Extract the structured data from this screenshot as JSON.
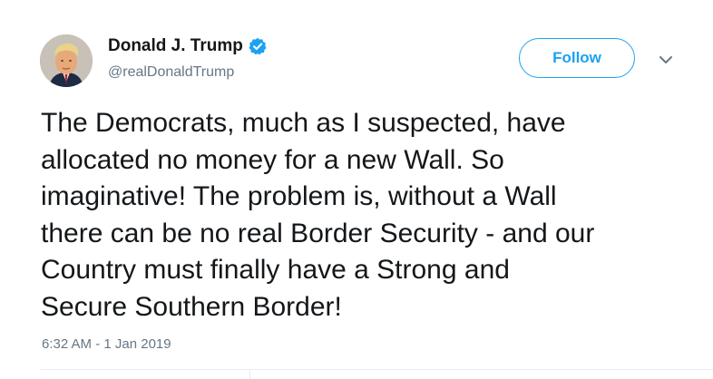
{
  "author": {
    "display_name": "Donald J. Trump",
    "handle": "@realDonaldTrump",
    "verified": true,
    "avatar_icon": "profile-photo"
  },
  "actions": {
    "follow_label": "Follow",
    "more_icon": "chevron-down-icon"
  },
  "tweet": {
    "text": "The Democrats, much as I suspected, have\nallocated no money for a new Wall. So\nimaginative! The problem is, without a Wall\nthere can be no real Border Security - and our\nCountry must finally have a Strong and\nSecure Southern Border!",
    "timestamp": "6:32 AM - 1 Jan 2019"
  },
  "colors": {
    "accent": "#1da1f2",
    "text": "#14171a",
    "secondary": "#657786",
    "divider": "#e6ecf0"
  }
}
